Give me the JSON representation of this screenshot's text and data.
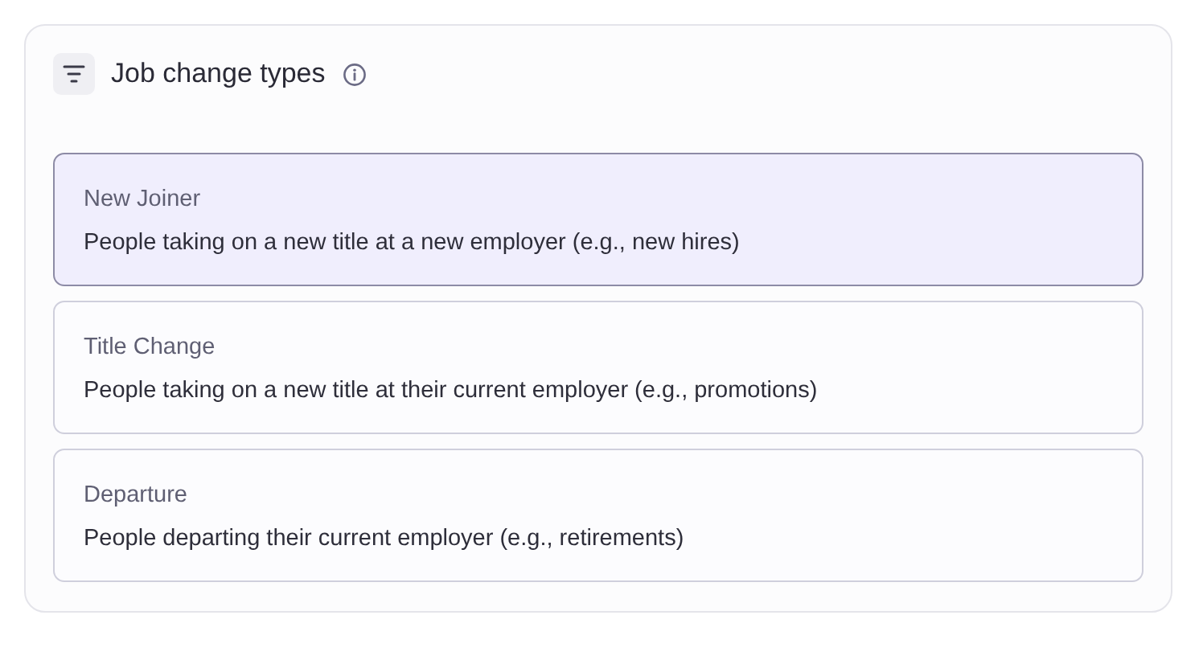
{
  "panel": {
    "title": "Job change types"
  },
  "options": [
    {
      "label": "New Joiner",
      "description": "People taking on a new title at a new employer (e.g., new hires)",
      "selected": true
    },
    {
      "label": "Title Change",
      "description": "People taking on a new title at their current employer (e.g., promotions)",
      "selected": false
    },
    {
      "label": "Departure",
      "description": "People departing their current employer (e.g., retirements)",
      "selected": false
    }
  ]
}
